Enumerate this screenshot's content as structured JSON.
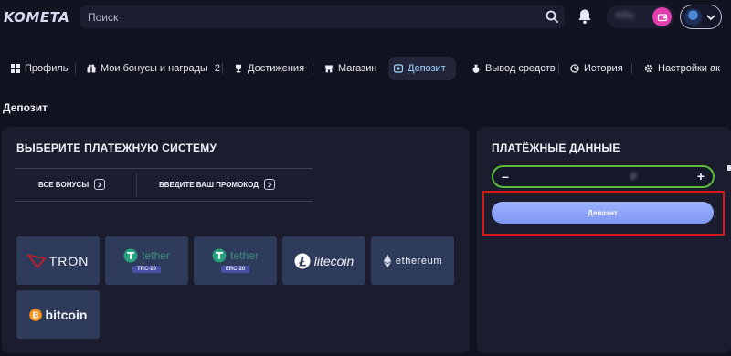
{
  "header": {
    "logo": "KOMETA",
    "search_placeholder": "Поиск",
    "balance": "KRa",
    "icons": {
      "search": "search-icon",
      "bell": "bell-icon",
      "wallet": "wallet-icon",
      "chevron": "chevron-down-icon"
    }
  },
  "nav": {
    "items": [
      {
        "label": "Профиль",
        "icon": "grid-icon"
      },
      {
        "label": "Мои бонусы и награды",
        "icon": "gift-icon",
        "count": "2"
      },
      {
        "label": "Достижения",
        "icon": "trophy-icon"
      },
      {
        "label": "Магазин",
        "icon": "shop-icon"
      },
      {
        "label": "Депозит",
        "icon": "deposit-icon",
        "active": true
      },
      {
        "label": "Вывод средств",
        "icon": "withdraw-icon"
      },
      {
        "label": "История",
        "icon": "history-icon"
      },
      {
        "label": "Настройки ак",
        "icon": "gear-icon"
      }
    ]
  },
  "page": {
    "title": "Депозит"
  },
  "payment_systems": {
    "heading": "ВЫБЕРИТЕ ПЛАТЕЖНУЮ СИСТЕМУ",
    "tabs": {
      "bonuses": "ВСЕ БОНУСЫ",
      "promo": "ВВЕДИТЕ ВАШ ПРОМОКОД"
    },
    "methods": [
      {
        "name": "TRON"
      },
      {
        "name": "tether",
        "network": "TRC-20"
      },
      {
        "name": "tether",
        "network": "ERC-20"
      },
      {
        "name": "litecoin"
      },
      {
        "name": "ethereum"
      },
      {
        "name": "bitcoin"
      }
    ]
  },
  "payment_details": {
    "heading": "ПЛАТЁЖНЫЕ ДАННЫЕ",
    "minus": "–",
    "plus": "+",
    "amount": "₽",
    "deposit_button": "Депозит"
  },
  "colors": {
    "background": "#11121f",
    "panel": "#1b1d2f",
    "card": "#2f3b5b",
    "accent": "#8ea4fb",
    "field_border": "#5cbc3a",
    "highlight": "#d21a1a",
    "wallet": "#e33cae"
  }
}
